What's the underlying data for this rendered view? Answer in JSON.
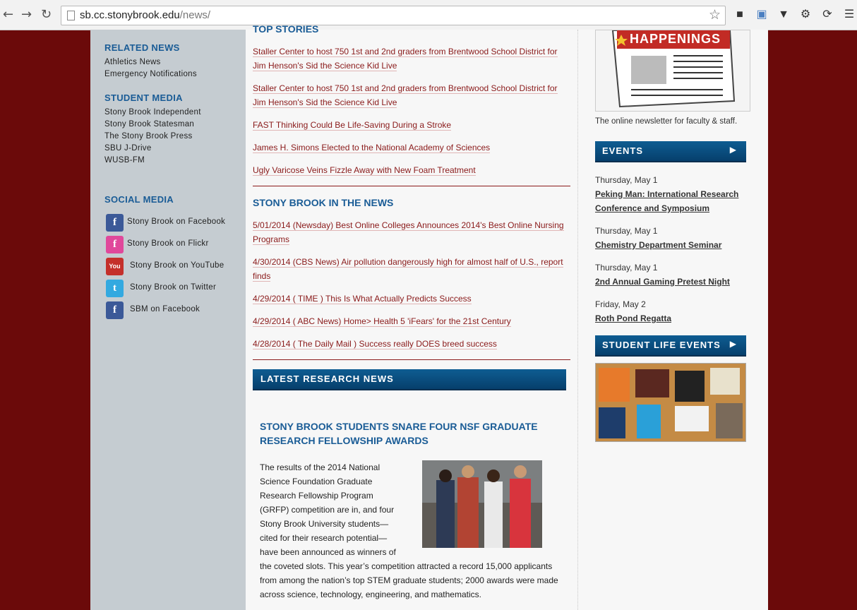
{
  "browser": {
    "url_host": "sb.cc.stonybrook.edu",
    "url_path": "/news/"
  },
  "left": {
    "related_heading": "RELATED NEWS",
    "related_links": [
      "Athletics News",
      "Emergency Notifications"
    ],
    "student_media_heading": "STUDENT MEDIA",
    "student_media_links": [
      "Stony Brook Independent",
      "Stony Brook Statesman",
      "The Stony Brook Press",
      "SBU J-Drive",
      "WUSB-FM"
    ],
    "social_heading": "SOCIAL MEDIA",
    "social_links": [
      {
        "label": "Stony Brook on Facebook",
        "icon": "facebook-icon",
        "glyph": "f",
        "color": "#3b5998"
      },
      {
        "label": "Stony Brook on Flickr",
        "icon": "flickr-icon",
        "glyph": "f",
        "color": "#e0489b"
      },
      {
        "label": "Stony Brook on YouTube",
        "icon": "youtube-icon",
        "glyph": "You",
        "color": "#c4302b"
      },
      {
        "label": "Stony Brook on Twitter",
        "icon": "twitter-icon",
        "glyph": "t",
        "color": "#33a9e0"
      },
      {
        "label": "SBM on Facebook",
        "icon": "facebook-icon",
        "glyph": "f",
        "color": "#3b5998"
      }
    ]
  },
  "main": {
    "top_stories_heading": "TOP STORIES",
    "top_stories": [
      "Staller Center to host 750 1st and 2nd graders from Brentwood School District for Jim Henson's Sid the Science Kid Live",
      "Staller Center to host 750 1st and 2nd graders from Brentwood School District for Jim Henson's Sid the Science Kid Live",
      "FAST Thinking Could Be Life-Saving During a Stroke",
      "James H. Simons Elected to the National Academy of Sciences",
      "Ugly Varicose Veins Fizzle Away with New Foam Treatment"
    ],
    "in_the_news_heading": "STONY BROOK IN THE NEWS",
    "in_the_news": [
      "5/01/2014 (Newsday) Best Online Colleges Announces 2014's Best Online Nursing Programs",
      "4/30/2014 (CBS News) Air pollution dangerously high for almost half of U.S., report finds",
      "4/29/2014 ( TIME ) This Is What Actually Predicts Success",
      "4/29/2014 ( ABC News) Home> Health 5 'iFears' for the 21st Century",
      "4/28/2014 ( The Daily Mail ) Success really DOES breed success"
    ],
    "research_bar": "LATEST RESEARCH NEWS",
    "article_title": "STONY BROOK STUDENTS SNARE FOUR NSF GRADUATE RESEARCH FELLOWSHIP AWARDS",
    "article_text_1": "The results of the 2014 National Science Foundation Graduate Research Fellowship Program (GRFP) competition are in, and four Stony Brook University students—cited for their research potential—have been announced as winners of",
    "article_text_2": "the coveted slots. This year’s competition attracted a record 15,000 applicants from among the nation’s top STEM graduate students; 2000 awards were made across science, technology, engineering, and mathematics."
  },
  "right": {
    "happenings_logo": "HAPPENINGS",
    "caption": "The online newsletter for faculty & staff.",
    "events_bar": "EVENTS",
    "events": [
      {
        "date": "Thursday, May 1",
        "title": "Peking Man: International Research Conference and Symposium"
      },
      {
        "date": "Thursday, May 1",
        "title": "Chemistry Department Seminar"
      },
      {
        "date": "Thursday, May 1",
        "title": "2nd Annual Gaming Pretest Night"
      },
      {
        "date": "Friday, May 2",
        "title": "Roth Pond Regatta"
      }
    ],
    "student_life_bar": "STUDENT LIFE EVENTS"
  }
}
